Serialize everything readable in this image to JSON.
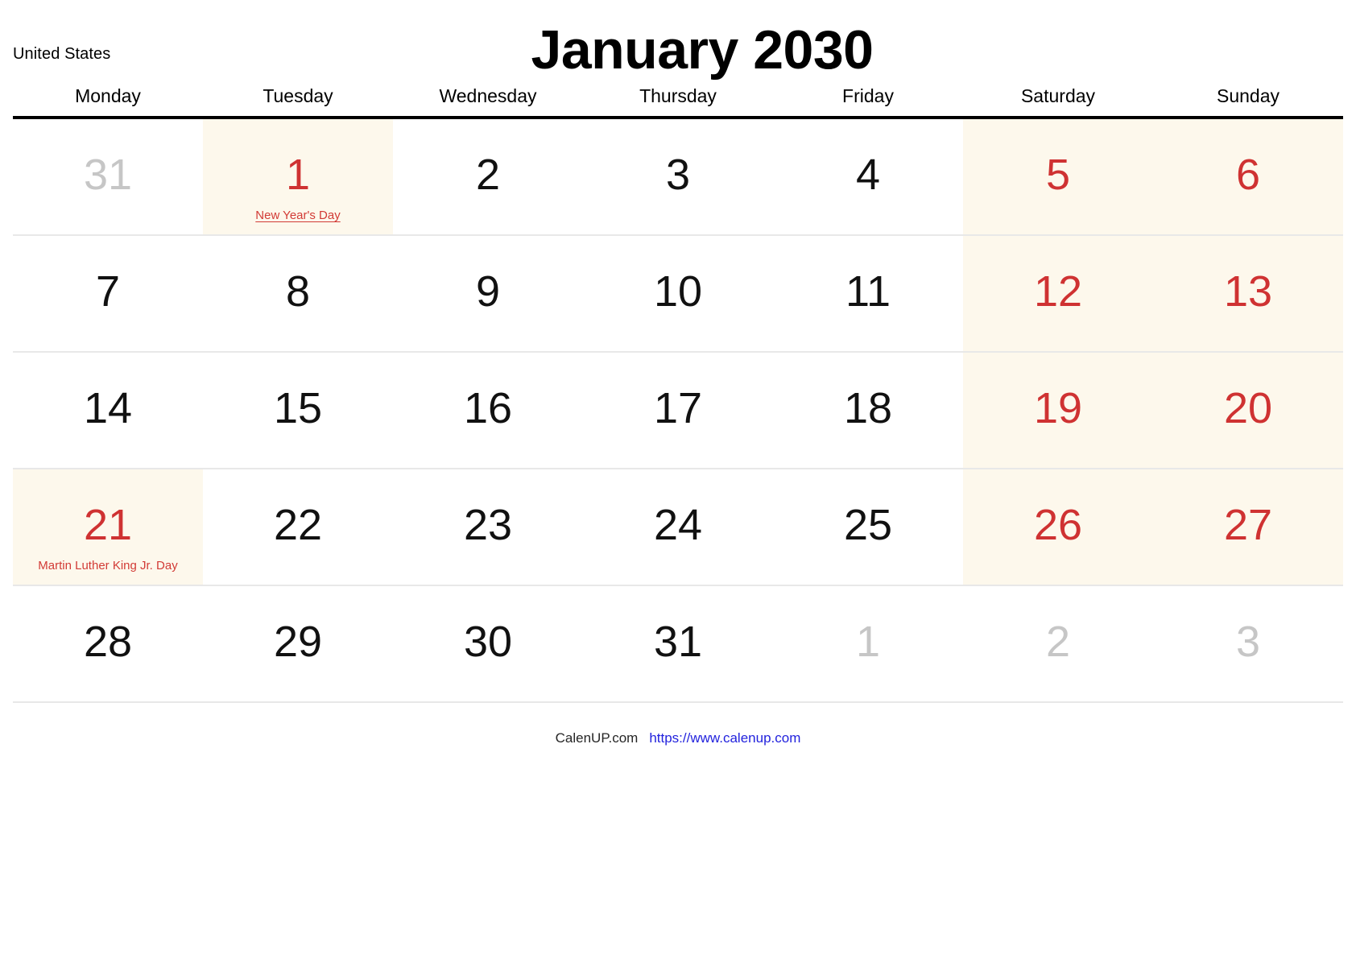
{
  "header": {
    "country": "United States",
    "title": "January 2030"
  },
  "weekdays": [
    "Monday",
    "Tuesday",
    "Wednesday",
    "Thursday",
    "Friday",
    "Saturday",
    "Sunday"
  ],
  "colors": {
    "holiday_red": "#cf3232",
    "weekend_bg": "#fdf8ec",
    "muted_gray": "#c6c6c6",
    "link_blue": "#2222dd",
    "header_rule": "#000000",
    "row_divider": "#e8e8e8"
  },
  "weeks": [
    [
      {
        "num": "31",
        "style": "muted",
        "bg": "none",
        "holiday": ""
      },
      {
        "num": "1",
        "style": "red",
        "bg": "holiday",
        "holiday": "New Year's Day",
        "holiday_link": true
      },
      {
        "num": "2",
        "style": "normal",
        "bg": "none",
        "holiday": ""
      },
      {
        "num": "3",
        "style": "normal",
        "bg": "none",
        "holiday": ""
      },
      {
        "num": "4",
        "style": "normal",
        "bg": "none",
        "holiday": ""
      },
      {
        "num": "5",
        "style": "red",
        "bg": "weekend",
        "holiday": ""
      },
      {
        "num": "6",
        "style": "red",
        "bg": "weekend",
        "holiday": ""
      }
    ],
    [
      {
        "num": "7",
        "style": "normal",
        "bg": "none",
        "holiday": ""
      },
      {
        "num": "8",
        "style": "normal",
        "bg": "none",
        "holiday": ""
      },
      {
        "num": "9",
        "style": "normal",
        "bg": "none",
        "holiday": ""
      },
      {
        "num": "10",
        "style": "normal",
        "bg": "none",
        "holiday": ""
      },
      {
        "num": "11",
        "style": "normal",
        "bg": "none",
        "holiday": ""
      },
      {
        "num": "12",
        "style": "red",
        "bg": "weekend",
        "holiday": ""
      },
      {
        "num": "13",
        "style": "red",
        "bg": "weekend",
        "holiday": ""
      }
    ],
    [
      {
        "num": "14",
        "style": "normal",
        "bg": "none",
        "holiday": ""
      },
      {
        "num": "15",
        "style": "normal",
        "bg": "none",
        "holiday": ""
      },
      {
        "num": "16",
        "style": "normal",
        "bg": "none",
        "holiday": ""
      },
      {
        "num": "17",
        "style": "normal",
        "bg": "none",
        "holiday": ""
      },
      {
        "num": "18",
        "style": "normal",
        "bg": "none",
        "holiday": ""
      },
      {
        "num": "19",
        "style": "red",
        "bg": "weekend",
        "holiday": ""
      },
      {
        "num": "20",
        "style": "red",
        "bg": "weekend",
        "holiday": ""
      }
    ],
    [
      {
        "num": "21",
        "style": "red",
        "bg": "holiday",
        "holiday": "Martin Luther King Jr. Day",
        "holiday_link": false
      },
      {
        "num": "22",
        "style": "normal",
        "bg": "none",
        "holiday": ""
      },
      {
        "num": "23",
        "style": "normal",
        "bg": "none",
        "holiday": ""
      },
      {
        "num": "24",
        "style": "normal",
        "bg": "none",
        "holiday": ""
      },
      {
        "num": "25",
        "style": "normal",
        "bg": "none",
        "holiday": ""
      },
      {
        "num": "26",
        "style": "red",
        "bg": "weekend",
        "holiday": ""
      },
      {
        "num": "27",
        "style": "red",
        "bg": "weekend",
        "holiday": ""
      }
    ],
    [
      {
        "num": "28",
        "style": "normal",
        "bg": "none",
        "holiday": ""
      },
      {
        "num": "29",
        "style": "normal",
        "bg": "none",
        "holiday": ""
      },
      {
        "num": "30",
        "style": "normal",
        "bg": "none",
        "holiday": ""
      },
      {
        "num": "31",
        "style": "normal",
        "bg": "none",
        "holiday": ""
      },
      {
        "num": "1",
        "style": "muted",
        "bg": "none",
        "holiday": ""
      },
      {
        "num": "2",
        "style": "muted",
        "bg": "none",
        "holiday": ""
      },
      {
        "num": "3",
        "style": "muted",
        "bg": "none",
        "holiday": ""
      }
    ]
  ],
  "footer": {
    "brand": "CalenUP.com",
    "url": "https://www.calenup.com"
  }
}
